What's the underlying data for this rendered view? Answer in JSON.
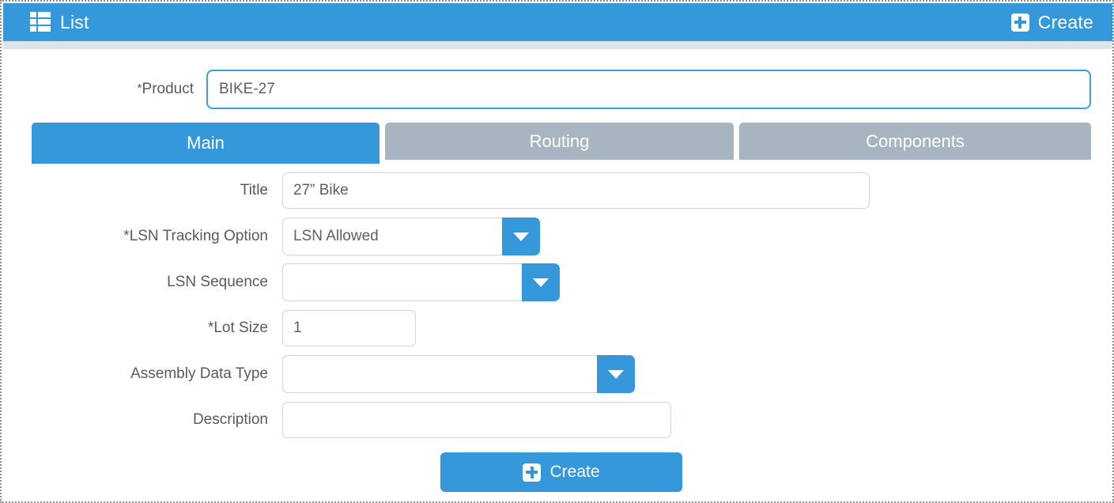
{
  "header": {
    "title": "List",
    "list_icon": "list-icon",
    "create_label": "Create",
    "create_icon": "plus-square-icon"
  },
  "product": {
    "label": "*Product",
    "label_star": "*",
    "label_text": "Product",
    "value": "BIKE-27",
    "placeholder": ""
  },
  "tabs": [
    {
      "label": "Main",
      "active": true
    },
    {
      "label": "Routing",
      "active": false
    },
    {
      "label": "Components",
      "active": false
    }
  ],
  "fields": {
    "title": {
      "label": "Title",
      "value": "27” Bike",
      "placeholder": ""
    },
    "lsn_tracking_option": {
      "label": "*LSN Tracking Option",
      "value": "LSN Allowed",
      "caret_icon": "chevron-down-icon"
    },
    "lsn_sequence": {
      "label": "LSN Sequence",
      "value": "",
      "caret_icon": "chevron-down-icon"
    },
    "lot_size": {
      "label": "*Lot Size",
      "value": "1",
      "placeholder": ""
    },
    "assembly_data_type": {
      "label": "Assembly Data Type",
      "value": "",
      "caret_icon": "chevron-down-icon"
    },
    "description": {
      "label": "Description",
      "value": "",
      "placeholder": ""
    }
  },
  "footer": {
    "create_label": "Create",
    "create_icon": "plus-square-icon"
  },
  "colors": {
    "accent": "#3498db",
    "tab_inactive": "#a6b5c0",
    "label_text": "#555b60",
    "border": "#cfd4d7",
    "strip": "#dde3e7"
  }
}
